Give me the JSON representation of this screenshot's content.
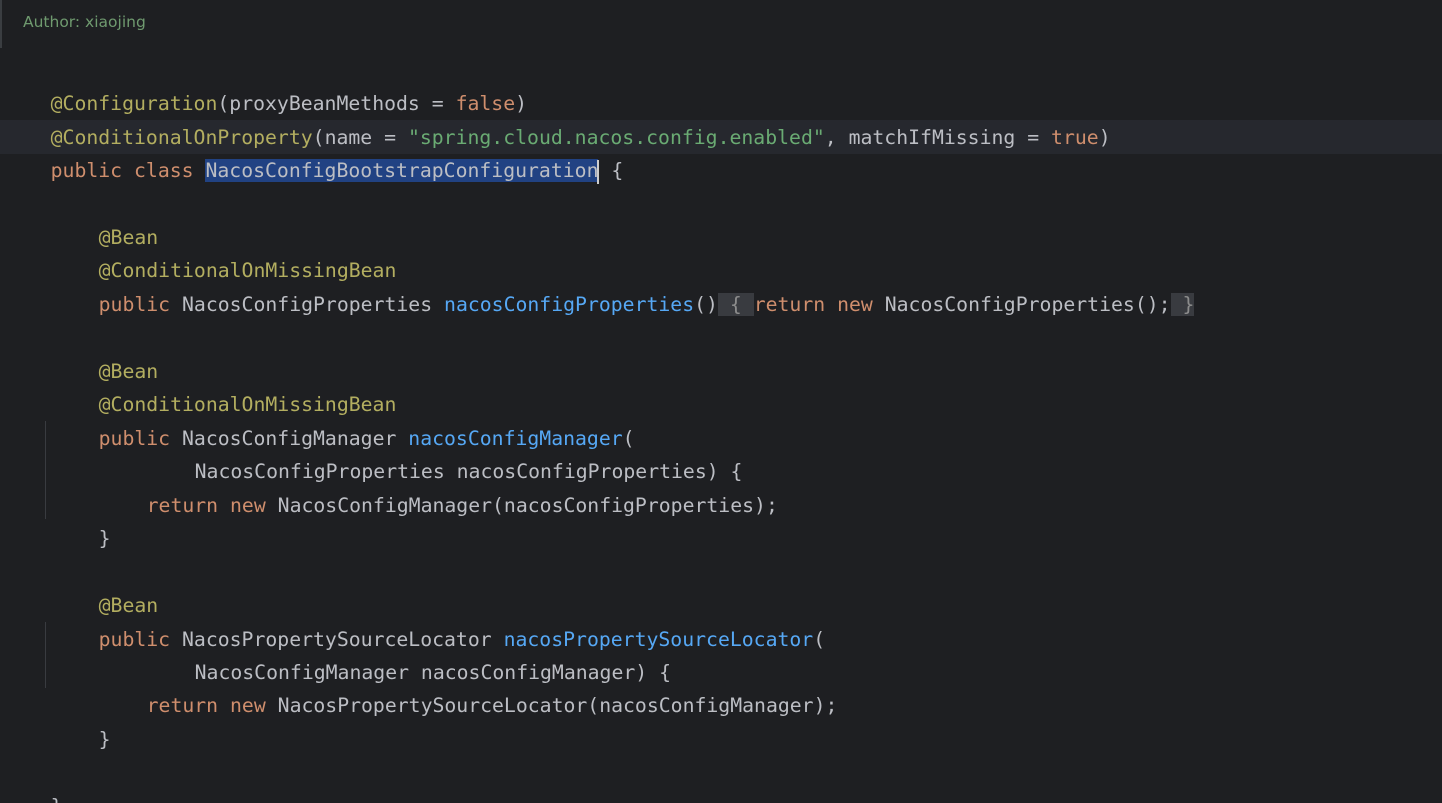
{
  "doc_comment": "Author: xiaojing",
  "code": {
    "l1": {
      "a": "@Configuration",
      "b": "(proxyBeanMethods = ",
      "c": "false",
      "d": ")"
    },
    "l2": {
      "a": "@ConditionalOnProperty",
      "b": "(name = ",
      "c": "\"spring.cloud.nacos.config.enabled\"",
      "d": ", matchIfMissing = ",
      "e": "true",
      "f": ")"
    },
    "l3": {
      "a": "public class ",
      "b": "NacosConfigBootstrapConfiguration",
      "c": " {"
    },
    "l5": {
      "a": "@Bean"
    },
    "l6": {
      "a": "@ConditionalOnMissingBean"
    },
    "l7": {
      "a": "public ",
      "b": "NacosConfigProperties ",
      "c": "nacosConfigProperties",
      "d": "()",
      "e": " { ",
      "f": "return new ",
      "g": "NacosConfigProperties();",
      "h": " }"
    },
    "l9": {
      "a": "@Bean"
    },
    "l10": {
      "a": "@ConditionalOnMissingBean"
    },
    "l11": {
      "a": "public ",
      "b": "NacosConfigManager ",
      "c": "nacosConfigManager",
      "d": "("
    },
    "l12": {
      "a": "NacosConfigProperties nacosConfigProperties) {"
    },
    "l13": {
      "a": "return new ",
      "b": "NacosConfigManager(nacosConfigProperties);"
    },
    "l14": {
      "a": "}"
    },
    "l16": {
      "a": "@Bean"
    },
    "l17": {
      "a": "public ",
      "b": "NacosPropertySourceLocator ",
      "c": "nacosPropertySourceLocator",
      "d": "("
    },
    "l18": {
      "a": "NacosConfigManager nacosConfigManager) {"
    },
    "l19": {
      "a": "return new ",
      "b": "NacosPropertySourceLocator(nacosConfigManager);"
    },
    "l20": {
      "a": "}"
    },
    "l22": {
      "a": "}"
    }
  },
  "colors": {
    "background": "#1e1f22",
    "annotation": "#b3ae60",
    "keyword": "#cf8e6d",
    "string": "#6aab73",
    "method": "#56a8f5",
    "text": "#bcbec4",
    "selection": "#214283",
    "comment": "#6f9a6f"
  }
}
